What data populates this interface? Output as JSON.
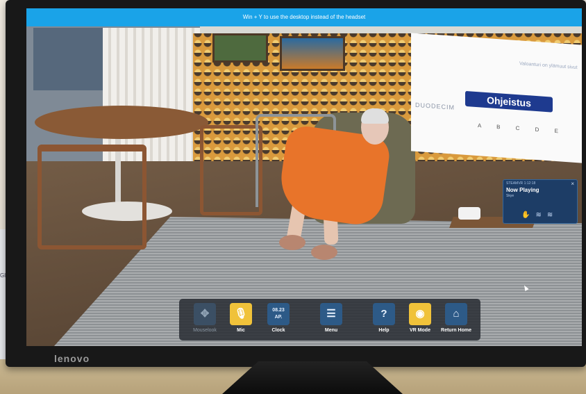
{
  "banner": {
    "text": "Win + Y to use the desktop instead of the headset"
  },
  "monitor": {
    "brand": "lenovo"
  },
  "desk_items": {
    "glove_box_label": "Gloves"
  },
  "instructions_board": {
    "button_label": "Ohjeistus",
    "brand": "DUODECIM",
    "letters": "A B C D E",
    "fine_print": "Valoanturi on ylämuut sivut"
  },
  "now_playing": {
    "app": "STEAMVR",
    "time": "1:12:18",
    "title": "Now Playing",
    "track": "Skye",
    "close": "×"
  },
  "taskbar": {
    "items": [
      {
        "label": "Mouselook",
        "icon": "move-arrows-icon",
        "glyph": "✥"
      },
      {
        "label": "Mic",
        "icon": "microphone-icon",
        "glyph": "🎙"
      },
      {
        "label": "Clock",
        "icon": "clock-icon",
        "time": "08.23",
        "ampm": "AP."
      },
      {
        "label": "Menu",
        "icon": "hamburger-menu-icon",
        "glyph": "☰"
      },
      {
        "label": "Help",
        "icon": "help-icon",
        "glyph": "?"
      },
      {
        "label": "VR Mode",
        "icon": "vr-headset-icon",
        "glyph": "◉"
      },
      {
        "label": "Return Home",
        "icon": "home-icon",
        "glyph": "⌂"
      }
    ]
  },
  "colors": {
    "banner": "#1aa3e8",
    "taskbar_accent": "#f0c23a",
    "panel": "#1d3d66"
  }
}
